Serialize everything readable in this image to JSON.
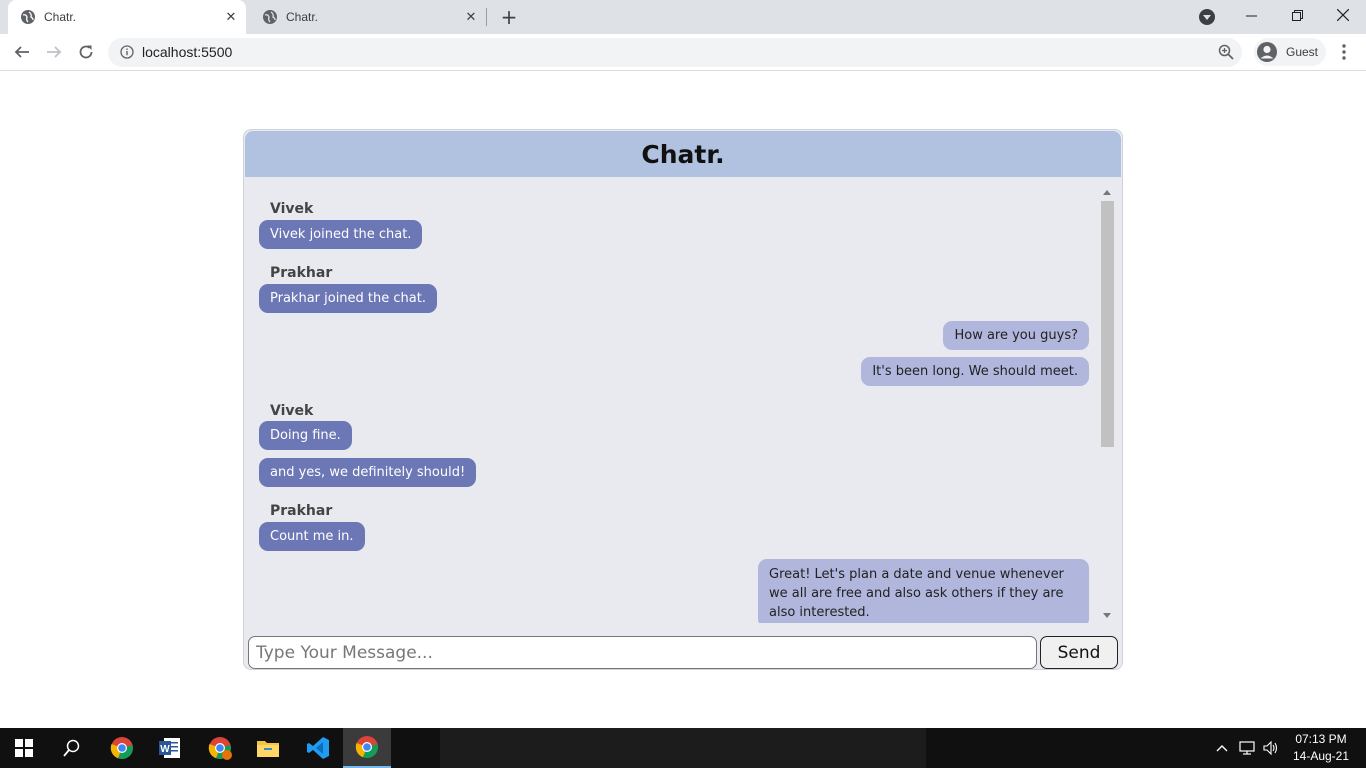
{
  "browser": {
    "tabs": [
      {
        "title": "Chatr.",
        "active": true
      },
      {
        "title": "Chatr.",
        "active": false
      }
    ],
    "url": "localhost:5500",
    "profile_label": "Guest"
  },
  "chat": {
    "title": "Chatr.",
    "messages": [
      {
        "sender": "Vivek",
        "text": "Vivek joined the chat.",
        "direction": "incoming"
      },
      {
        "sender": "Prakhar",
        "text": "Prakhar joined the chat.",
        "direction": "incoming"
      },
      {
        "text": "How are you guys?",
        "direction": "outgoing"
      },
      {
        "text": "It's been long. We should meet.",
        "direction": "outgoing"
      },
      {
        "sender": "Vivek",
        "text": "Doing fine.",
        "direction": "incoming"
      },
      {
        "text": "and yes, we definitely should!",
        "direction": "incoming"
      },
      {
        "sender": "Prakhar",
        "text": "Count me in.",
        "direction": "incoming"
      },
      {
        "text": "Great! Let's plan a date and venue whenever we all are free and also ask others if they are also interested.",
        "direction": "outgoing"
      }
    ],
    "input_placeholder": "Type Your Message...",
    "send_label": "Send"
  },
  "taskbar": {
    "time": "07:13 PM",
    "date": "14-Aug-21"
  },
  "colors": {
    "header_bg": "#b1c2e1",
    "incoming_bubble": "#6c77b5",
    "outgoing_bubble": "#b1b6dc",
    "chat_bg": "#e8eaf0"
  }
}
